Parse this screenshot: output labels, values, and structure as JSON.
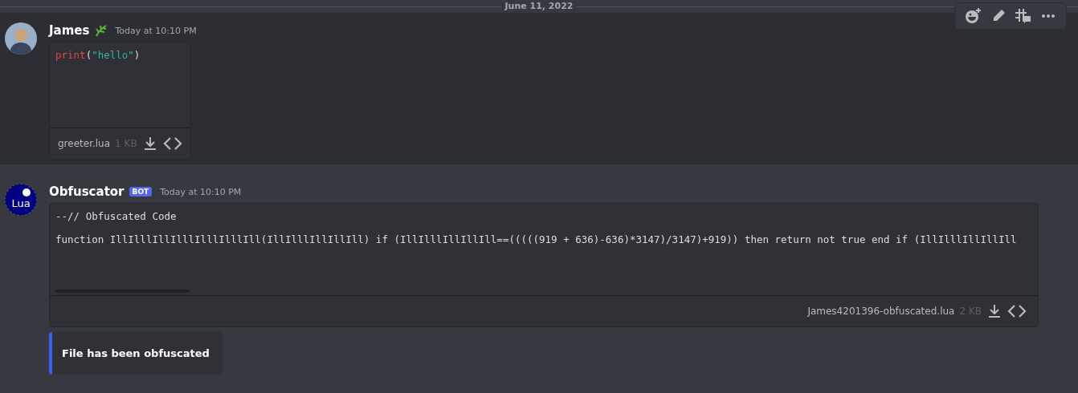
{
  "date_divider": "June 11, 2022",
  "messages": [
    {
      "author": "James",
      "timestamp": "Today at 10:10 PM",
      "hovered": true,
      "avatar": {
        "kind": "photo"
      },
      "attachment": {
        "preview": [
          {
            "kind": "code_lua",
            "tokens": [
              {
                "text": "print",
                "color": "#e0474b"
              },
              {
                "text": "("
              },
              {
                "text": "\"hello\"",
                "color": "#2fb59a"
              },
              {
                "text": ")"
              }
            ]
          }
        ],
        "filename": "greeter.lua",
        "size": "1 KB",
        "wide": false
      }
    },
    {
      "author": "Obfuscator",
      "bot_tag": "BOT",
      "timestamp": "Today at 10:10 PM",
      "hovered": false,
      "avatar": {
        "kind": "logo",
        "label": "Lua"
      },
      "attachment": {
        "preview": [
          {
            "kind": "plain",
            "text": "--// Obfuscated Code"
          },
          {
            "kind": "plain",
            "text": "function IllIlllIllIlllIlllIlllIll(IllIlllIllIllIll) if (IllIlllIllIllIll==(((((919 + 636)-636)*3147)/3147)+919)) then return not true end if (IllIlllIllIllIll"
          }
        ],
        "filename": "James4201396-obfuscated.lua",
        "size": "2 KB",
        "wide": true
      },
      "embed": {
        "title": "File has been obfuscated",
        "color": "#3a5ff2"
      }
    }
  ]
}
